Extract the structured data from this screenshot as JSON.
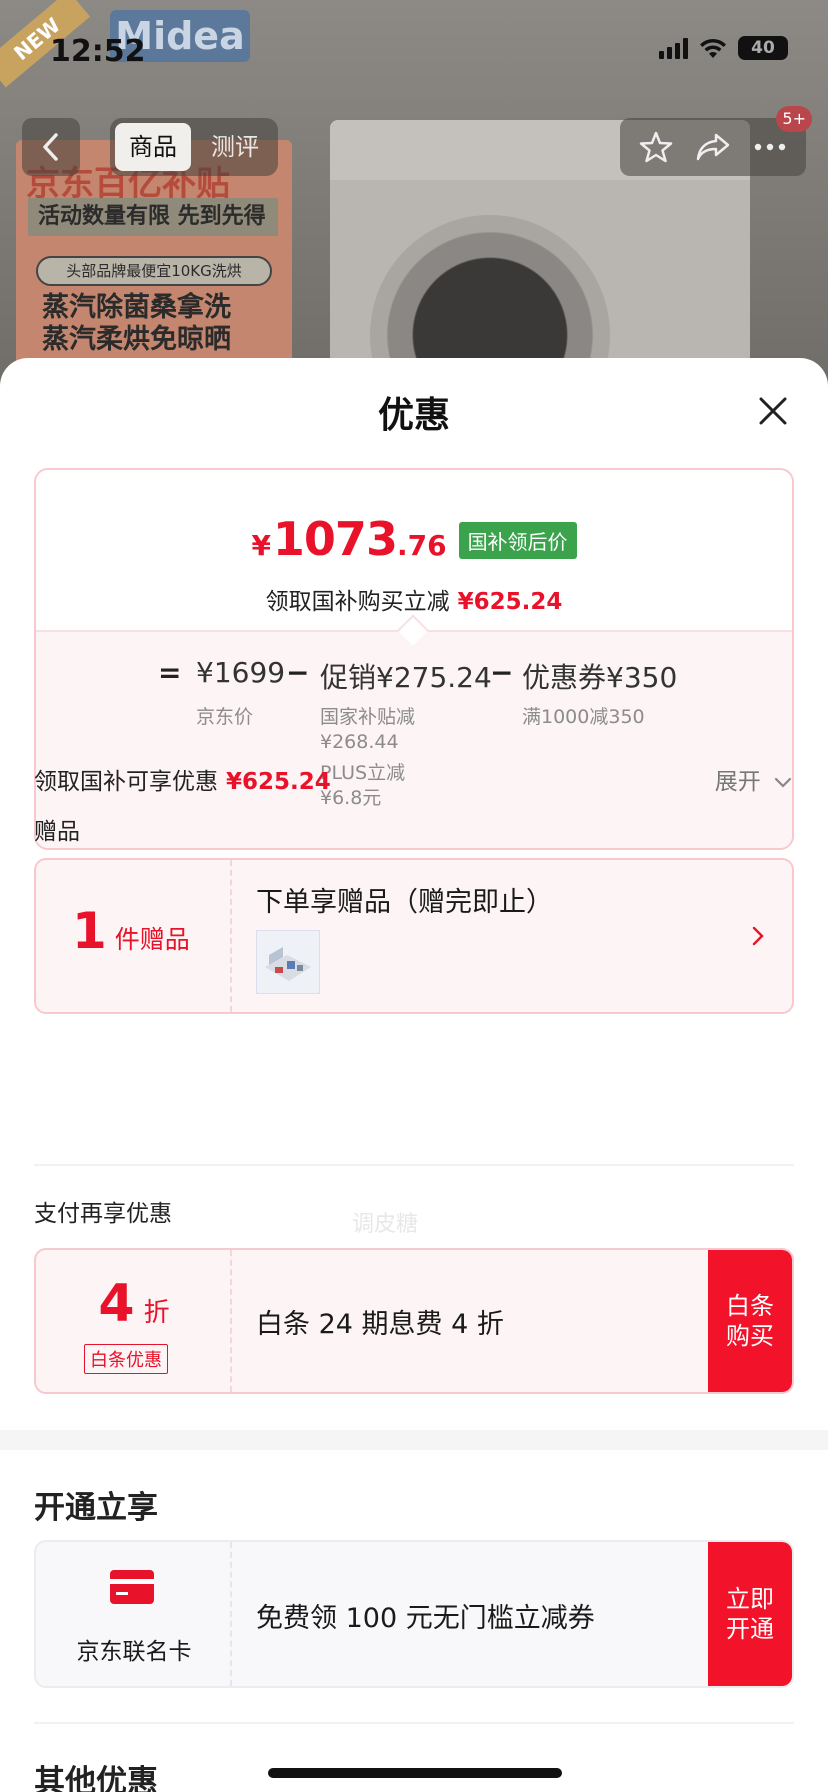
{
  "status_bar": {
    "time": "12:52",
    "battery": "40"
  },
  "background": {
    "brand_logo": "Midea",
    "new_tag": "NEW",
    "promo_title": "京东百亿补贴",
    "promo_strip": "活动数量有限 先到先得",
    "promo_pill": "头部品牌最便宜10KG洗烘",
    "promo_lines": [
      "蒸汽除菌桑拿洗",
      "蒸汽柔烘免晾晒"
    ]
  },
  "nav": {
    "tabs": [
      "商品",
      "测评"
    ],
    "active_tab": 0,
    "cart_badge": "5+",
    "icons": [
      "chevron-left-icon",
      "star-icon",
      "share-icon",
      "more-icon"
    ]
  },
  "sheet": {
    "title": "优惠",
    "price": {
      "currency": "¥",
      "integer": "1073",
      "decimal": ".76",
      "tag": "国补领后价",
      "reduce_label": "领取国补购买立减",
      "reduce_value": "¥625.24"
    },
    "formula": {
      "equals": "=",
      "base_value": "¥1699",
      "base_label": "京东价",
      "minus1": "−",
      "promo_value": "促销¥275.24",
      "promo_sub1_label": "国家补贴减",
      "promo_sub1_value": "¥268.44",
      "promo_sub2_label": "PLUS立减",
      "promo_sub2_value": "¥6.8元",
      "minus2": "−",
      "coupon_value": "优惠券¥350",
      "coupon_label": "满1000减350"
    },
    "summary": {
      "label": "领取国补可享优惠",
      "value": "¥625.24",
      "expand": "展开"
    },
    "watermark": "调皮糖",
    "gifts": {
      "section_title": "赠品",
      "count": "1",
      "count_unit": "件赠品",
      "text": "下单享赠品（赠完即止）"
    },
    "payment": {
      "section_title": "支付再享优惠",
      "discount": "4",
      "discount_unit": "折",
      "badge": "白条优惠",
      "text": "白条 24 期息费 4 折",
      "button": "白条\n购买"
    },
    "open": {
      "section_title": "开通立享",
      "card_name": "京东联名卡",
      "text": "免费领 100 元无门槛立减券",
      "button": "立即\n开通"
    },
    "other": {
      "section_title": "其他优惠"
    }
  },
  "colors": {
    "accent_red": "#e8132a",
    "tag_green": "#3aa34c",
    "card_bg": "#fdf4f5",
    "card_border": "#f7c9cf"
  }
}
